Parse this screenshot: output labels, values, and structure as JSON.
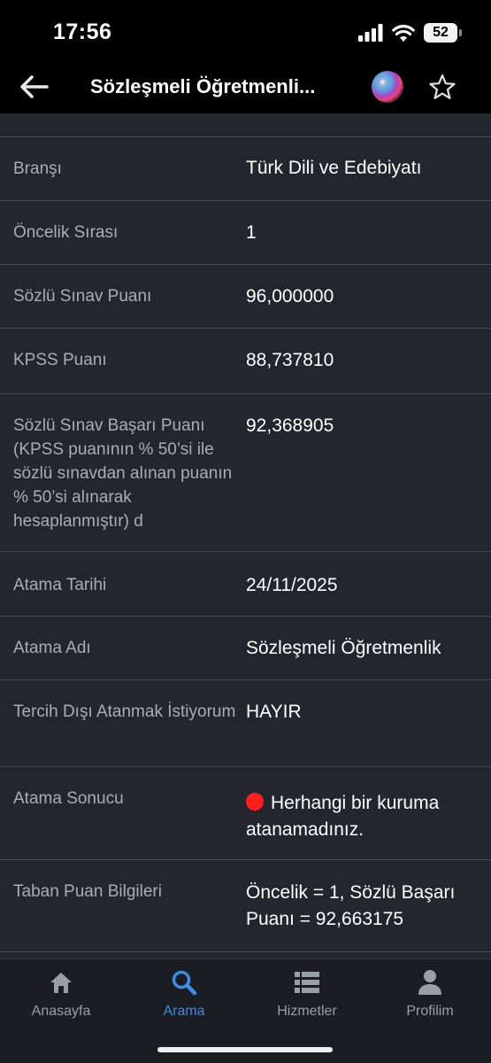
{
  "status_bar": {
    "time": "17:56",
    "battery": "52",
    "icons": [
      "signal-icon",
      "wifi-icon",
      "battery-icon"
    ]
  },
  "app_bar": {
    "title": "Sözleşmeli Öğretmenli...",
    "icons": [
      "back-arrow-icon",
      "siri-icon",
      "star-icon"
    ]
  },
  "details": {
    "brans_label": "Branşı",
    "brans_value": "Türk Dili ve Edebiyatı",
    "oncelik_label": "Öncelik Sırası",
    "oncelik_value": "1",
    "sozlu_label": "Sözlü Sınav Puanı",
    "sozlu_value": "96,000000",
    "kpss_label": "KPSS Puanı",
    "kpss_value": "88,737810",
    "basari_label": "Sözlü Sınav Başarı Puanı (KPSS puanının % 50’si ile sözlü sınavdan alınan puanın % 50’si alınarak hesaplanmıştır) d",
    "basari_value": "92,368905",
    "tarih_label": "Atama Tarihi",
    "tarih_value": "24/11/2025",
    "adi_label": "Atama Adı",
    "adi_value": "Sözleşmeli Öğretmenlik",
    "tercih_label": "Tercih Dışı Atanmak İstiyorum",
    "tercih_value": "HAYIR",
    "sonuc_label": "Atama Sonucu",
    "sonuc_value": "Herhangi bir kuruma atanamadınız.",
    "sonuc_status_color": "#ff1f1f",
    "taban_label": "Taban Puan Bilgileri",
    "taban_value": "Öncelik = 1, Sözlü Başarı Puanı = 92,663175"
  },
  "tab_bar": {
    "tabs": [
      {
        "label": "Anasayfa",
        "icon": "home-icon"
      },
      {
        "label": "Arama",
        "icon": "search-icon",
        "active": true
      },
      {
        "label": "Hizmetler",
        "icon": "services-list-icon"
      },
      {
        "label": "Profilim",
        "icon": "profile-icon"
      }
    ],
    "active_color": "#3a8ee6"
  }
}
